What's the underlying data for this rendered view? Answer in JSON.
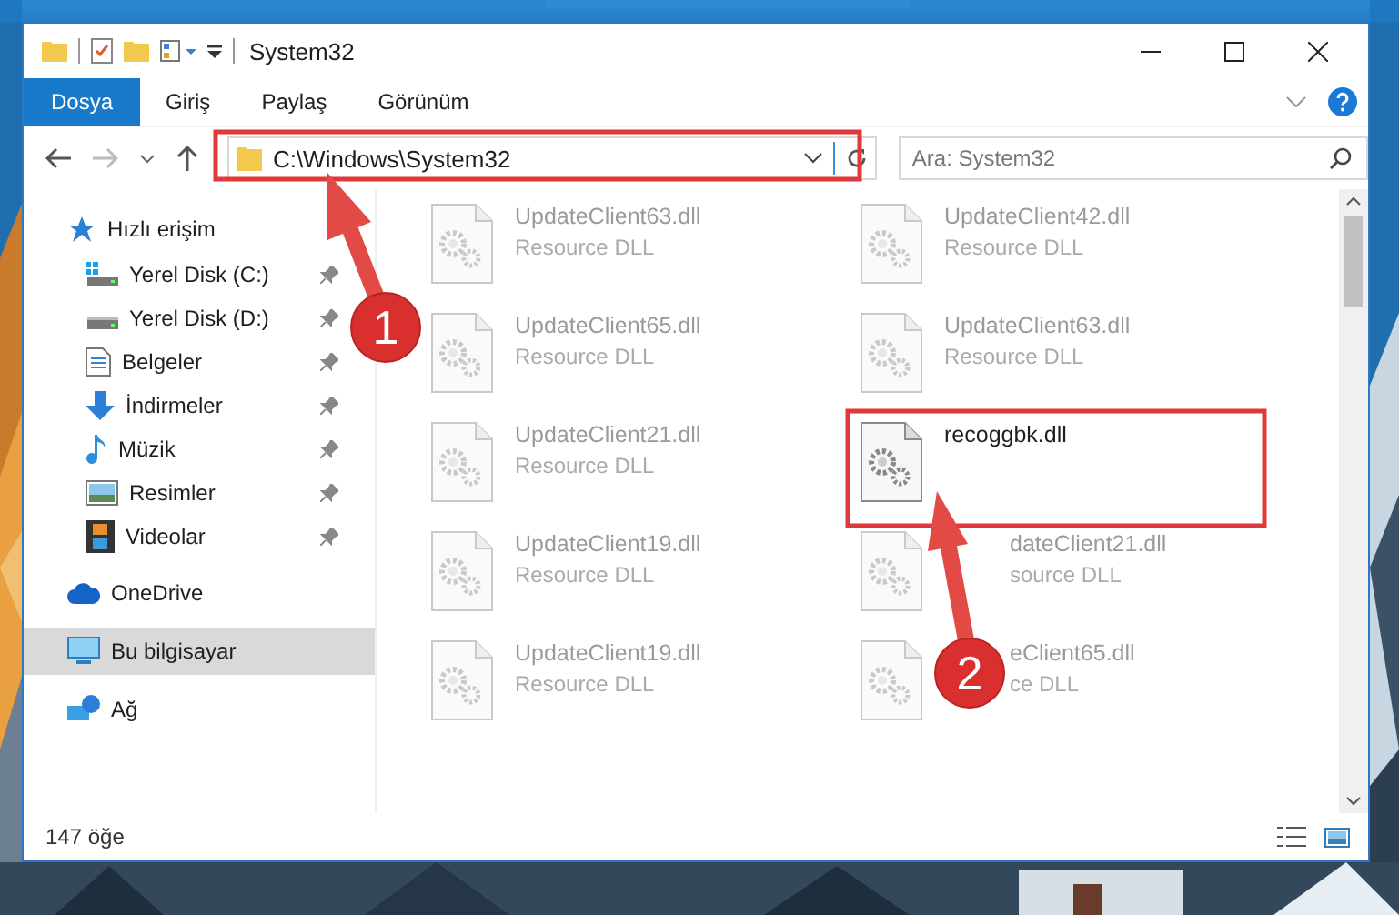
{
  "window": {
    "title": "System32"
  },
  "ribbon_tabs": [
    {
      "label": "Dosya",
      "kind": "file"
    },
    {
      "label": "Giriş",
      "kind": "tab"
    },
    {
      "label": "Paylaş",
      "kind": "tab"
    },
    {
      "label": "Görünüm",
      "kind": "tab"
    }
  ],
  "address": {
    "path": "C:\\Windows\\System32"
  },
  "search": {
    "placeholder": "Ara: System32"
  },
  "sidebar": {
    "items": [
      {
        "label": "Hızlı erişim",
        "selected": false,
        "children": [
          {
            "label": "Yerel Disk (C:)",
            "pinned": true
          },
          {
            "label": "Yerel Disk (D:)",
            "pinned": true
          },
          {
            "label": "Belgeler",
            "pinned": true
          },
          {
            "label": "İndirmeler",
            "pinned": true
          },
          {
            "label": "Müzik",
            "pinned": true
          },
          {
            "label": "Resimler",
            "pinned": true
          },
          {
            "label": "Videolar",
            "pinned": true
          }
        ]
      },
      {
        "label": "OneDrive",
        "selected": false
      },
      {
        "label": "Bu bilgisayar",
        "selected": true
      },
      {
        "label": "Ağ",
        "selected": false
      }
    ]
  },
  "files": [
    {
      "name": "UpdateClient63.dll",
      "type": "Resource DLL",
      "kind": "blurred"
    },
    {
      "name": "UpdateClient42.dll",
      "type": "Resource DLL",
      "kind": "blurred"
    },
    {
      "name": "UpdateClient65.dll",
      "type": "Resource DLL",
      "kind": "blurred"
    },
    {
      "name": "UpdateClient63.dll",
      "type": "Resource DLL",
      "kind": "blurred"
    },
    {
      "name": "UpdateClient21.dll",
      "type": "Resource DLL",
      "kind": "blurred"
    },
    {
      "name": "recoggbk.dll",
      "kind": "clear"
    },
    {
      "name": "UpdateClient19.dll",
      "type": "Resource DLL",
      "kind": "blurred"
    },
    {
      "name": "dateClient21.dll",
      "type": "source DLL",
      "kind": "covered"
    },
    {
      "name": "UpdateClient19.dll",
      "type": "Resource DLL",
      "kind": "blurred"
    },
    {
      "name": "eClient65.dll",
      "type": "ce DLL",
      "kind": "covered"
    }
  ],
  "status_bar": {
    "count": "147 öğe"
  },
  "annotations": [
    {
      "number": "1"
    },
    {
      "number": "2"
    }
  ]
}
